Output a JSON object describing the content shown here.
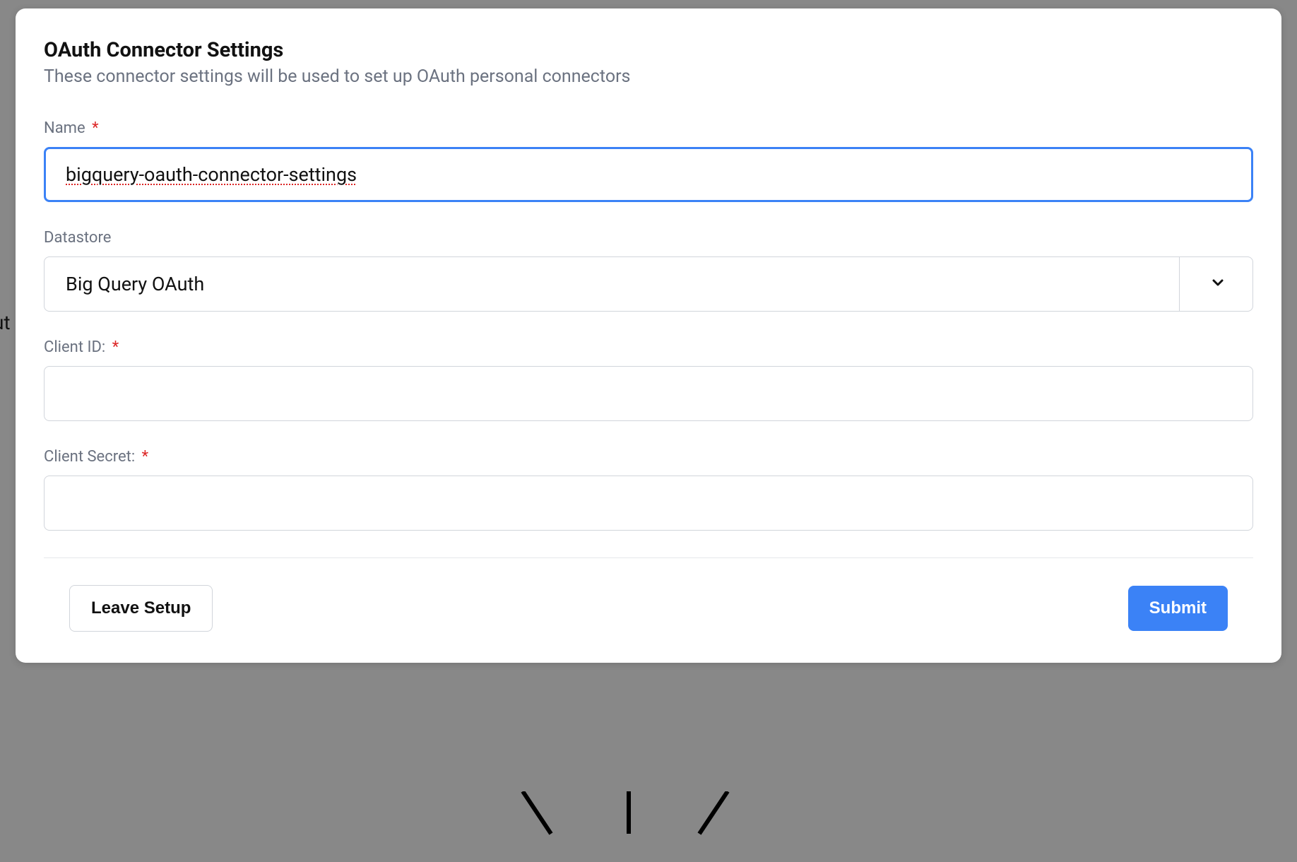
{
  "modal": {
    "title": "OAuth Connector Settings",
    "subtitle": "These connector settings will be used to set up OAuth personal connectors"
  },
  "form": {
    "name": {
      "label": "Name",
      "required": true,
      "value": "bigquery-oauth-connector-settings"
    },
    "datastore": {
      "label": "Datastore",
      "selected": "Big Query OAuth"
    },
    "client_id": {
      "label": "Client ID:",
      "required": true,
      "value": ""
    },
    "client_secret": {
      "label": "Client Secret:",
      "required": true,
      "value": ""
    }
  },
  "buttons": {
    "leave": "Leave Setup",
    "submit": "Submit"
  },
  "asterisk": "*",
  "background": {
    "partial_text": "ut"
  }
}
